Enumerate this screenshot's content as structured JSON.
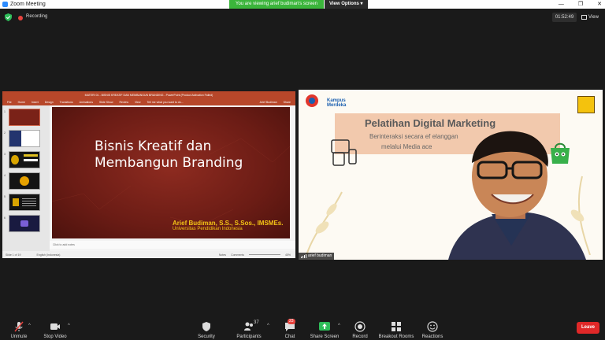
{
  "window": {
    "title": "Zoom Meeting",
    "controls": [
      "—",
      "❐",
      "✕"
    ]
  },
  "banner": {
    "viewing_text": "You are viewing arief budiman's screen",
    "view_options_label": "View Options"
  },
  "status": {
    "recording_label": "Recording",
    "timer": "01:52:49",
    "view_label": "View"
  },
  "share": {
    "window_title": "MATERI 01 - BISNIS KREATIF DAN MEMBANGUN BRANDING - PowerPoint (Product Activation Failed)",
    "menu_items": [
      "File",
      "Home",
      "Insert",
      "Design",
      "Transitions",
      "Animations",
      "Slide Show",
      "Review",
      "View",
      "Tell me what you want to do..."
    ],
    "menu_right": [
      "Arief Budiman",
      "Share"
    ],
    "slide_numbers": [
      "1",
      "2",
      "3",
      "4",
      "5",
      "6"
    ],
    "slide_title_line1": "Bisnis Kreatif dan",
    "slide_title_line2": "Membangun Branding",
    "slide_author": "Arief Budiman, S.S., S.Sos., IMSMEs.",
    "slide_university": "Universitas Pendidikan Indonesia",
    "notes_placeholder": "Click to add notes",
    "status_slide": "Slide 1 of 19",
    "status_language": "English (Indonesia)",
    "status_notes": "Notes",
    "status_comments": "Comments",
    "status_zoom": "45%"
  },
  "video": {
    "kampus_line1": "Kampus",
    "kampus_line2": "Merdeka",
    "heading": "Pelatihan Digital Marketing",
    "sub_line1": "Berinteraksi secara ef          elanggan",
    "sub_line2": "melalui Media              ace",
    "participant_name": "arief budiman"
  },
  "toolbar": {
    "unmute": "Unmute",
    "stop_video": "Stop Video",
    "security": "Security",
    "participants": "Participants",
    "participants_count": "37",
    "chat": "Chat",
    "chat_badge": "23",
    "share_screen": "Share Screen",
    "record": "Record",
    "breakout": "Breakout Rooms",
    "reactions": "Reactions",
    "leave": "Leave"
  },
  "colors": {
    "share_green": "#3bb53b",
    "powerpoint_red": "#b7472a",
    "slide_red": "#7a2218",
    "slide_gold": "#f3c316",
    "leave_red": "#e02828",
    "zoom_blue": "#2d8cff"
  }
}
